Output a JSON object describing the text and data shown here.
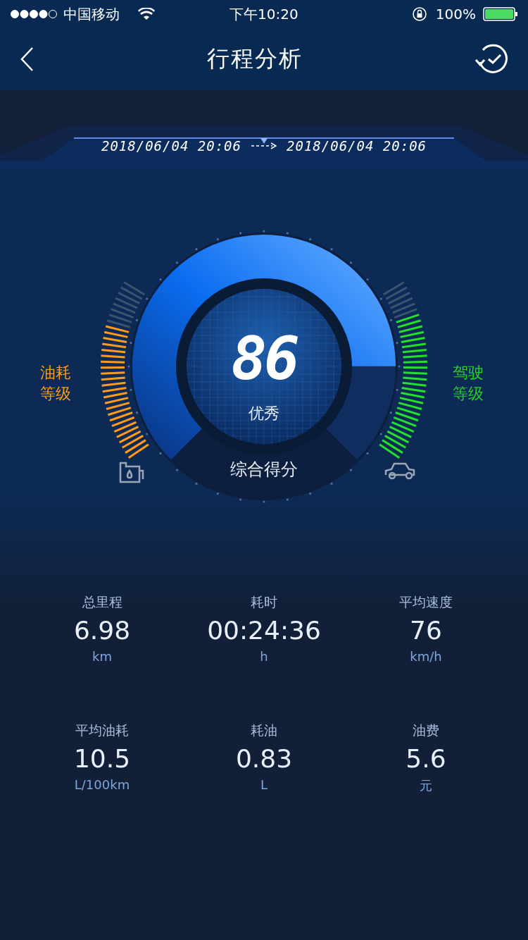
{
  "status_bar": {
    "carrier": "中国移动",
    "time": "下午10:20",
    "battery": "100%"
  },
  "nav": {
    "title": "行程分析"
  },
  "trip": {
    "start": "2018/06/04 20:06",
    "end": "2018/06/04 20:06"
  },
  "score": {
    "value": "86",
    "grade": "优秀",
    "label": "综合得分"
  },
  "fuel_meter": {
    "label": "油耗等级"
  },
  "driving_meter": {
    "label": "驾驶等级"
  },
  "stats": [
    {
      "label": "总里程",
      "value": "6.98",
      "unit": "km"
    },
    {
      "label": "耗时",
      "value": "00:24:36",
      "unit": "h"
    },
    {
      "label": "平均速度",
      "value": "76",
      "unit": "km/h"
    },
    {
      "label": "平均油耗",
      "value": "10.5",
      "unit": "L/100km"
    },
    {
      "label": "耗油",
      "value": "0.83",
      "unit": "L"
    },
    {
      "label": "油费",
      "value": "5.6",
      "unit": "元"
    }
  ]
}
